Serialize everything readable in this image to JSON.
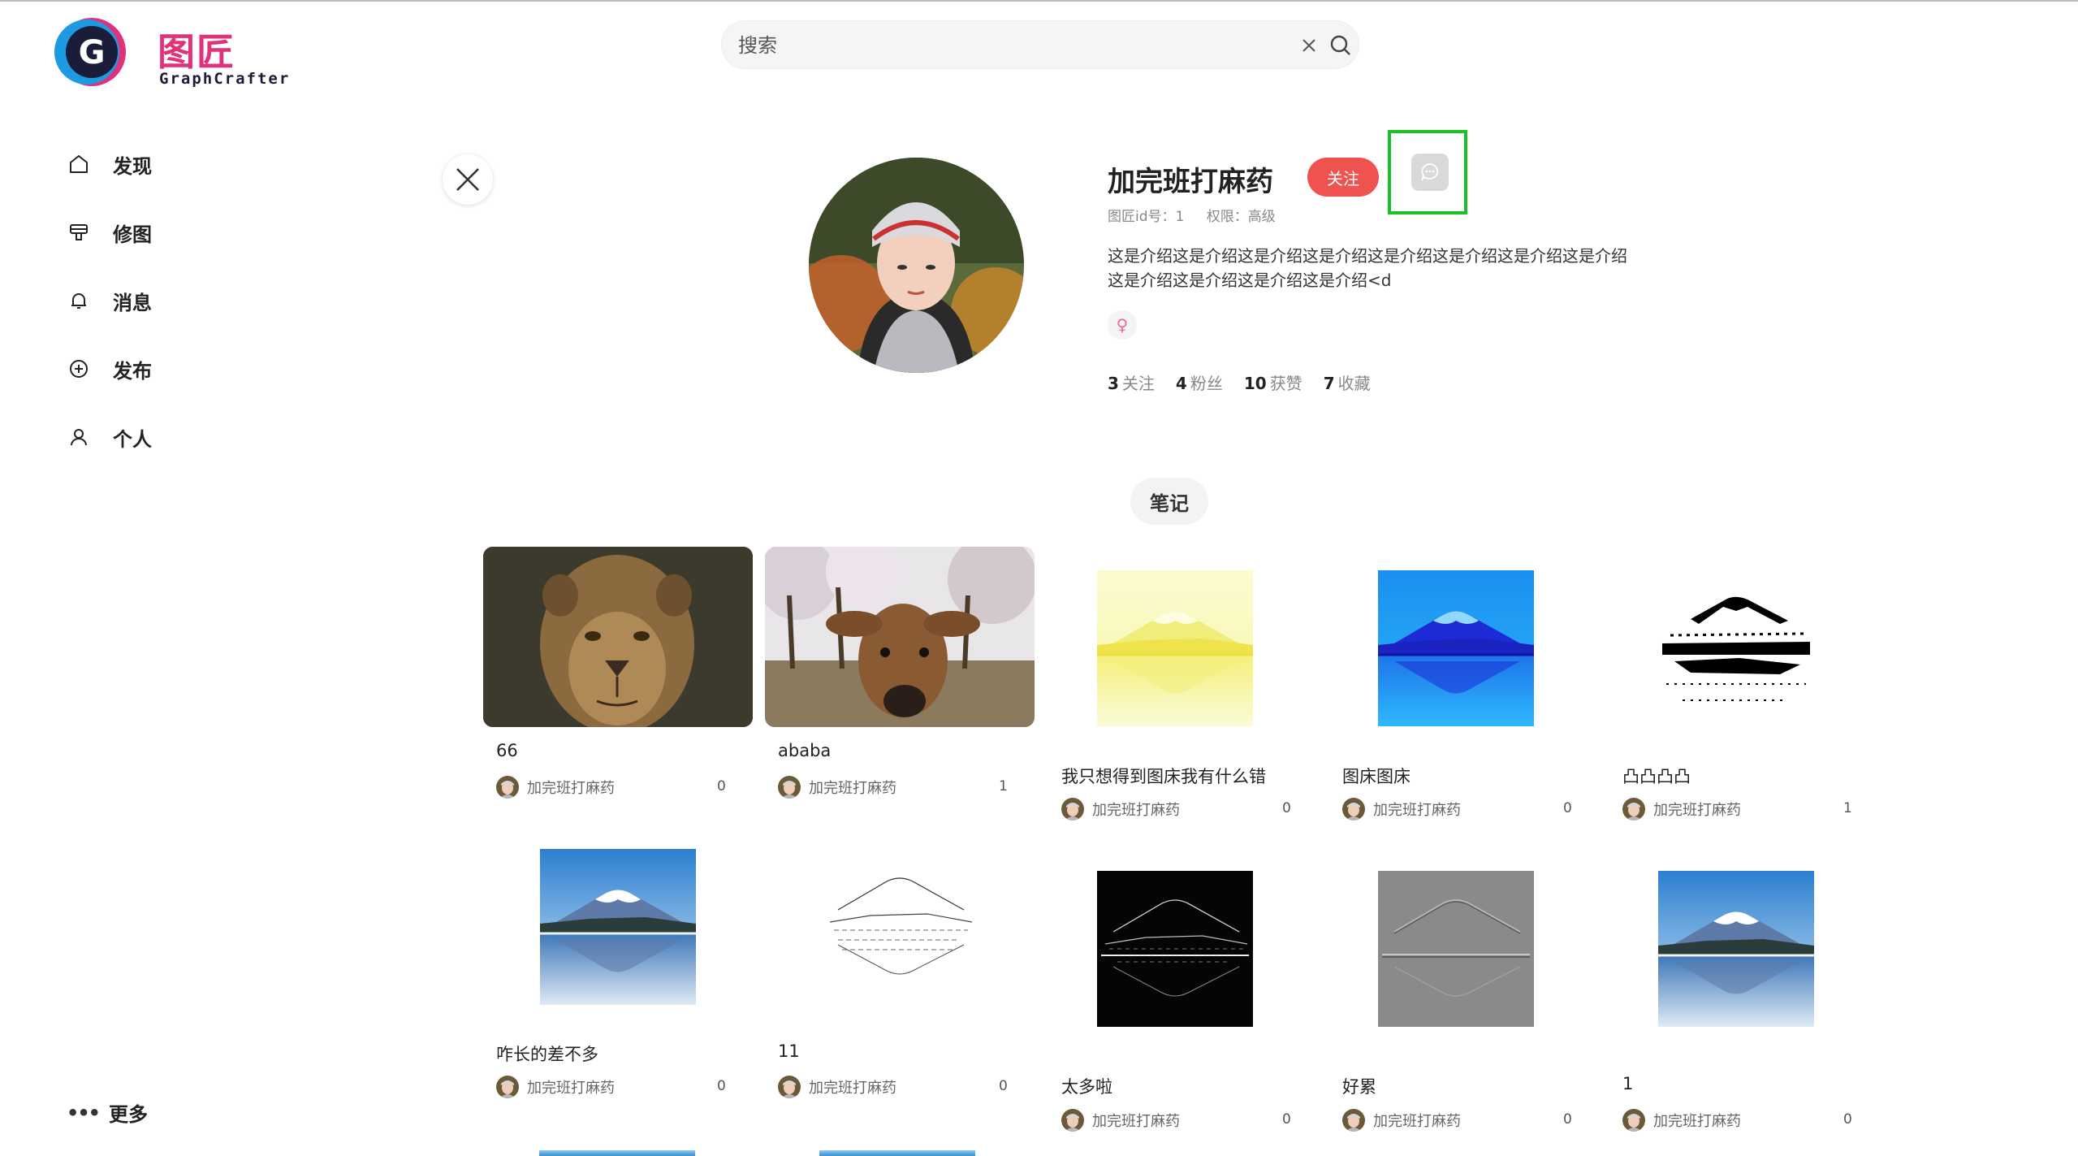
{
  "app": {
    "logo_cn": "图匠",
    "logo_en": "GraphCrafter",
    "logo_letter": "G"
  },
  "search": {
    "placeholder": "搜索"
  },
  "sidebar": {
    "items": [
      {
        "label": "发现",
        "icon": "home-icon"
      },
      {
        "label": "修图",
        "icon": "edit-image-icon"
      },
      {
        "label": "消息",
        "icon": "bell-icon"
      },
      {
        "label": "发布",
        "icon": "plus-circle-icon"
      },
      {
        "label": "个人",
        "icon": "user-icon"
      }
    ],
    "more": "更多"
  },
  "profile": {
    "name": "加完班打麻药",
    "follow_label": "关注",
    "id_text": "图匠id号：1",
    "role_text": "权限：高级",
    "bio_line1": "这是介绍这是介绍这是介绍这是介绍这是介绍这是介绍这是介绍这是介绍",
    "bio_line2": "这是介绍这是介绍这是介绍这是介绍<d",
    "gender_symbol": "♀",
    "stats": [
      {
        "num": "3",
        "label": "关注"
      },
      {
        "num": "4",
        "label": "粉丝"
      },
      {
        "num": "10",
        "label": "获赞"
      },
      {
        "num": "7",
        "label": "收藏"
      }
    ]
  },
  "tabs": {
    "notes": "笔记"
  },
  "notes": [
    {
      "title": "66",
      "author": "加完班打麻药",
      "likes": "0",
      "image": "lioness-photo"
    },
    {
      "title": "ababa",
      "author": "加完班打麻药",
      "likes": "1",
      "image": "deer-photo"
    },
    {
      "title": "我只想得到图床我有什么错",
      "author": "加完班打麻药",
      "likes": "0",
      "image": "fuji-yellow"
    },
    {
      "title": "图床图床",
      "author": "加完班打麻药",
      "likes": "0",
      "image": "fuji-blue"
    },
    {
      "title": "凸凸凸凸",
      "author": "加完班打麻药",
      "likes": "1",
      "image": "fuji-bw"
    },
    {
      "title": "咋长的差不多",
      "author": "加完班打麻药",
      "likes": "0",
      "image": "fuji-photo"
    },
    {
      "title": "11",
      "author": "加完班打麻药",
      "likes": "0",
      "image": "fuji-sketch"
    },
    {
      "title": "太多啦",
      "author": "加完班打麻药",
      "likes": "0",
      "image": "fuji-edges-dark"
    },
    {
      "title": "好累",
      "author": "加完班打麻药",
      "likes": "0",
      "image": "fuji-emboss"
    },
    {
      "title": "1",
      "author": "加完班打麻药",
      "likes": "0",
      "image": "fuji-photo"
    }
  ],
  "colors": {
    "follow": "#ef5350",
    "highlight": "#19c126",
    "logo_pink": "#e0317a",
    "logo_blue": "#1e9be0"
  }
}
